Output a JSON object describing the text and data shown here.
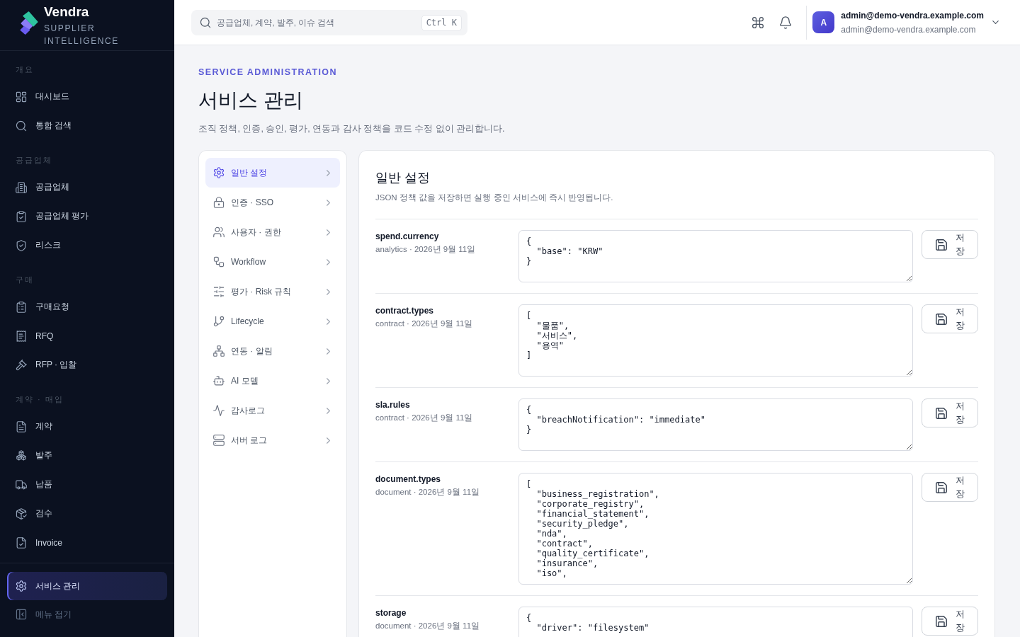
{
  "sidebar": {
    "brand": {
      "name": "Vendra",
      "tagline": "SUPPLIER INTELLIGENCE"
    },
    "sections": [
      {
        "label": "개요",
        "items": [
          {
            "label": "대시보드",
            "selected": false
          },
          {
            "label": "통합 검색",
            "selected": false
          }
        ]
      },
      {
        "label": "공급업체",
        "items": [
          {
            "label": "공급업체",
            "selected": false
          },
          {
            "label": "공급업체 평가",
            "selected": false
          },
          {
            "label": "리스크",
            "selected": false
          }
        ]
      },
      {
        "label": "구매",
        "items": [
          {
            "label": "구매요청",
            "selected": false
          },
          {
            "label": "RFQ",
            "selected": false
          },
          {
            "label": "RFP · 입찰",
            "selected": false
          }
        ]
      },
      {
        "label": "계약 · 매입",
        "items": [
          {
            "label": "계약",
            "selected": false
          },
          {
            "label": "발주",
            "selected": false
          },
          {
            "label": "납품",
            "selected": false
          },
          {
            "label": "검수",
            "selected": false
          },
          {
            "label": "Invoice",
            "selected": false
          }
        ]
      }
    ],
    "footer_items": [
      {
        "label": "서비스 관리",
        "selected": true
      }
    ],
    "collapse": "메뉴 접기"
  },
  "topbar": {
    "search": {
      "placeholder": "공급업체, 계약, 발주, 이슈 검색",
      "shortcut": "Ctrl K"
    },
    "user": {
      "avatar": "A",
      "name": "admin@demo-vendra.example.com",
      "email": "admin@demo-vendra.example.com"
    }
  },
  "page": {
    "eyebrow": "SERVICE ADMINISTRATION",
    "title": "서비스 관리",
    "subtitle": "조직 정책, 인증, 승인, 평가, 연동과 감사 정책을 코드 수정 없이 관리합니다."
  },
  "settings_nav": [
    {
      "label": "일반 설정",
      "selected": true
    },
    {
      "label": "인증 · SSO",
      "selected": false
    },
    {
      "label": "사용자 · 권한",
      "selected": false
    },
    {
      "label": "Workflow",
      "selected": false
    },
    {
      "label": "평가 · Risk 규칙",
      "selected": false
    },
    {
      "label": "Lifecycle",
      "selected": false
    },
    {
      "label": "연동 · 알림",
      "selected": false
    },
    {
      "label": "AI 모델",
      "selected": false
    },
    {
      "label": "감사로그",
      "selected": false
    },
    {
      "label": "서버 로그",
      "selected": false
    }
  ],
  "panel": {
    "title": "일반 설정",
    "description": "JSON 정책 값을 저장하면 실행 중인 서비스에 즉시 반영됩니다.",
    "settings": [
      {
        "key": "spend.currency",
        "meta": "analytics · 2026년 9월 11일",
        "value": "{\n  \"base\": \"KRW\"\n}",
        "button": "저장"
      },
      {
        "key": "contract.types",
        "meta": "contract · 2026년 9월 11일",
        "value": "[\n  \"물품\",\n  \"서비스\",\n  \"용역\"\n]",
        "button": "저장"
      },
      {
        "key": "sla.rules",
        "meta": "contract · 2026년 9월 11일",
        "value": "{\n  \"breachNotification\": \"immediate\"\n}",
        "button": "저장"
      },
      {
        "key": "document.types",
        "meta": "document · 2026년 9월 11일",
        "value": "[\n  \"business_registration\",\n  \"corporate_registry\",\n  \"financial_statement\",\n  \"security_pledge\",\n  \"nda\",\n  \"contract\",\n  \"quality_certificate\",\n  \"insurance\",\n  \"iso\",",
        "button": "저장"
      },
      {
        "key": "storage",
        "meta": "document · 2026년 9월 11일",
        "value": "{\n  \"driver\": \"filesystem\"",
        "button": "저장"
      }
    ]
  }
}
